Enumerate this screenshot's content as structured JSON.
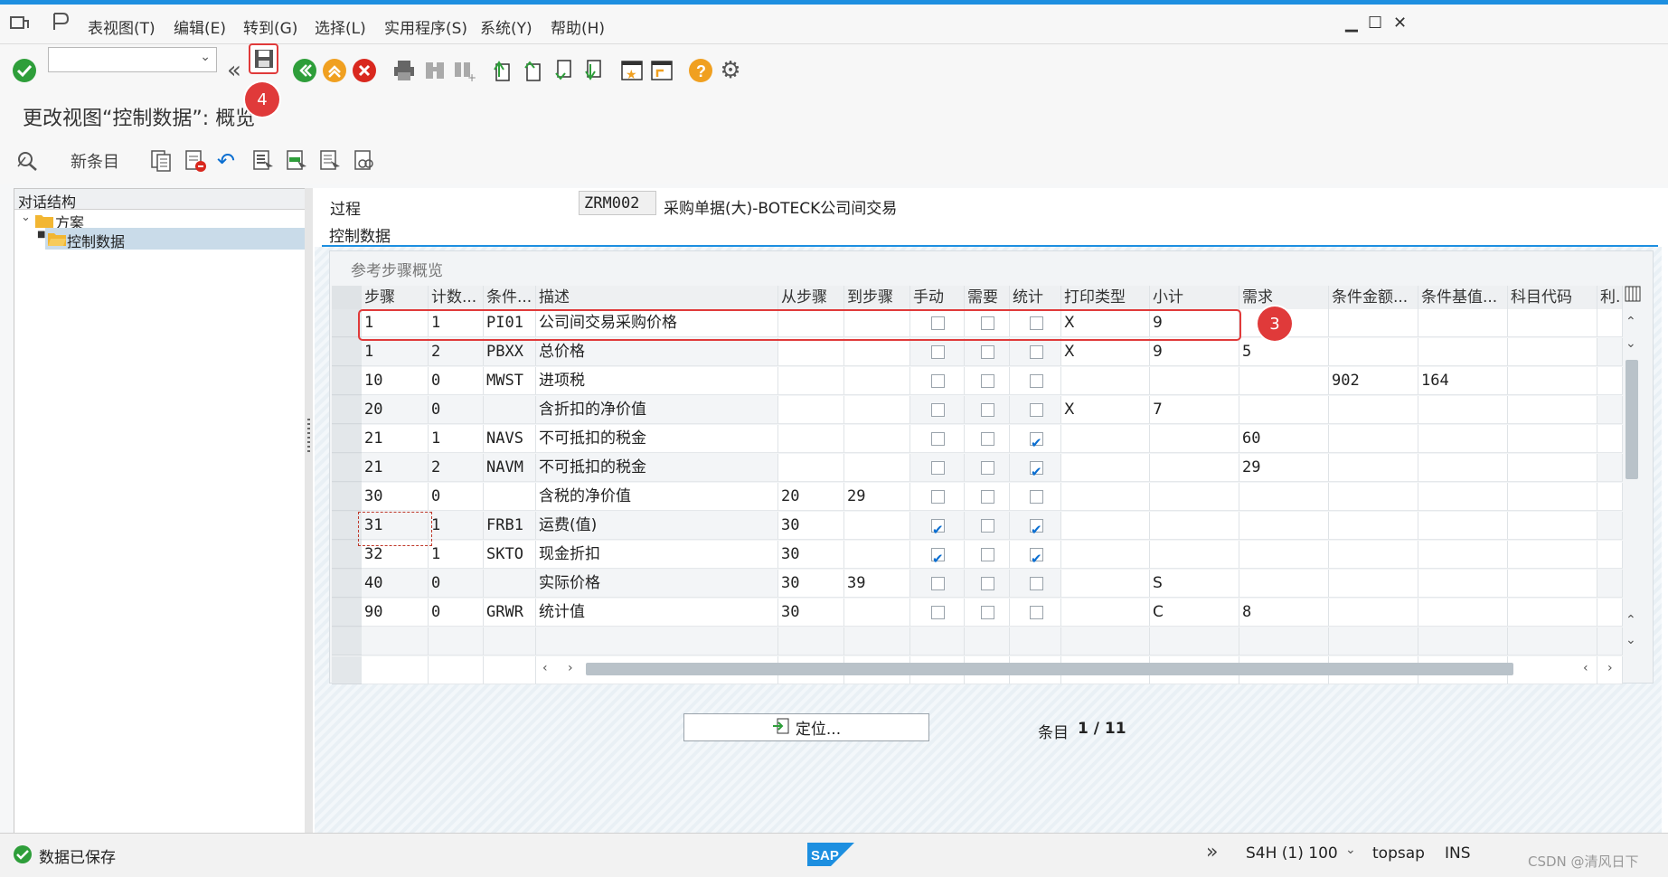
{
  "menu": {
    "items": [
      "表视图(T)",
      "编辑(E)",
      "转到(G)",
      "选择(L)",
      "实用程序(S)",
      "系统(Y)",
      "帮助(H)"
    ]
  },
  "title": "更改视图“控制数据”: 概览",
  "app_toolbar": {
    "new_entries": "新条目"
  },
  "tree": {
    "header": "对话结构",
    "root": "方案",
    "child": "控制数据"
  },
  "header_fields": {
    "procedure_label": "过程",
    "procedure_code": "ZRM002",
    "procedure_desc": "采购单据(大)-BOTECK公司间交易",
    "section": "控制数据"
  },
  "table": {
    "title": "参考步骤概览",
    "columns": [
      "步骤",
      "计数...",
      "条件...",
      "描述",
      "从步骤",
      "到步骤",
      "手动",
      "需要",
      "统计",
      "打印类型",
      "小计",
      "需求",
      "条件金额...",
      "条件基值...",
      "科目代码",
      "利..."
    ],
    "rows": [
      {
        "step": "1",
        "cnt": "1",
        "cond": "PI01",
        "desc": "公司间交易采购价格",
        "from": "",
        "to": "",
        "manual": false,
        "req": false,
        "stat": false,
        "print": "X",
        "sub": "9",
        "need": "",
        "amt": "",
        "base": "",
        "acct": ""
      },
      {
        "step": "1",
        "cnt": "2",
        "cond": "PBXX",
        "desc": "总价格",
        "from": "",
        "to": "",
        "manual": false,
        "req": false,
        "stat": false,
        "print": "X",
        "sub": "9",
        "need": "5",
        "amt": "",
        "base": "",
        "acct": ""
      },
      {
        "step": "10",
        "cnt": "0",
        "cond": "MWST",
        "desc": "进项税",
        "from": "",
        "to": "",
        "manual": false,
        "req": false,
        "stat": false,
        "print": "",
        "sub": "",
        "need": "",
        "amt": "902",
        "base": "164",
        "acct": ""
      },
      {
        "step": "20",
        "cnt": "0",
        "cond": "",
        "desc": "含折扣的净价值",
        "from": "",
        "to": "",
        "manual": false,
        "req": false,
        "stat": false,
        "print": "X",
        "sub": "7",
        "need": "",
        "amt": "",
        "base": "",
        "acct": ""
      },
      {
        "step": "21",
        "cnt": "1",
        "cond": "NAVS",
        "desc": "不可抵扣的税金",
        "from": "",
        "to": "",
        "manual": false,
        "req": false,
        "stat": true,
        "print": "",
        "sub": "",
        "need": "60",
        "amt": "",
        "base": "",
        "acct": ""
      },
      {
        "step": "21",
        "cnt": "2",
        "cond": "NAVM",
        "desc": "不可抵扣的税金",
        "from": "",
        "to": "",
        "manual": false,
        "req": false,
        "stat": true,
        "print": "",
        "sub": "",
        "need": "29",
        "amt": "",
        "base": "",
        "acct": ""
      },
      {
        "step": "30",
        "cnt": "0",
        "cond": "",
        "desc": "含税的净价值",
        "from": "20",
        "to": "29",
        "manual": false,
        "req": false,
        "stat": false,
        "print": "",
        "sub": "",
        "need": "",
        "amt": "",
        "base": "",
        "acct": ""
      },
      {
        "step": "31",
        "cnt": "1",
        "cond": "FRB1",
        "desc": "运费(值)",
        "from": "30",
        "to": "",
        "manual": true,
        "req": false,
        "stat": true,
        "print": "",
        "sub": "",
        "need": "",
        "amt": "",
        "base": "",
        "acct": ""
      },
      {
        "step": "32",
        "cnt": "1",
        "cond": "SKTO",
        "desc": "现金折扣",
        "from": "30",
        "to": "",
        "manual": true,
        "req": false,
        "stat": true,
        "print": "",
        "sub": "",
        "need": "",
        "amt": "",
        "base": "",
        "acct": ""
      },
      {
        "step": "40",
        "cnt": "0",
        "cond": "",
        "desc": "实际价格",
        "from": "30",
        "to": "39",
        "manual": false,
        "req": false,
        "stat": false,
        "print": "",
        "sub": "S",
        "need": "",
        "amt": "",
        "base": "",
        "acct": ""
      },
      {
        "step": "90",
        "cnt": "0",
        "cond": "GRWR",
        "desc": "统计值",
        "from": "30",
        "to": "",
        "manual": false,
        "req": false,
        "stat": false,
        "print": "",
        "sub": "C",
        "need": "8",
        "amt": "",
        "base": "",
        "acct": ""
      }
    ]
  },
  "position_button": "定位...",
  "entry_count_label": "条目",
  "entry_count_value": "1 / 11",
  "annotations": {
    "badge_save": "4",
    "badge_row": "3"
  },
  "status": {
    "message": "数据已保存",
    "system": "S4H (1) 100",
    "user": "topsap",
    "mode": "INS",
    "watermark": "CSDN @清风日下"
  },
  "colors": {
    "accent": "#1d8fe0",
    "annotation": "#e03a3a",
    "check": "#0a6ed1",
    "ok_green": "#2e9e3a"
  }
}
